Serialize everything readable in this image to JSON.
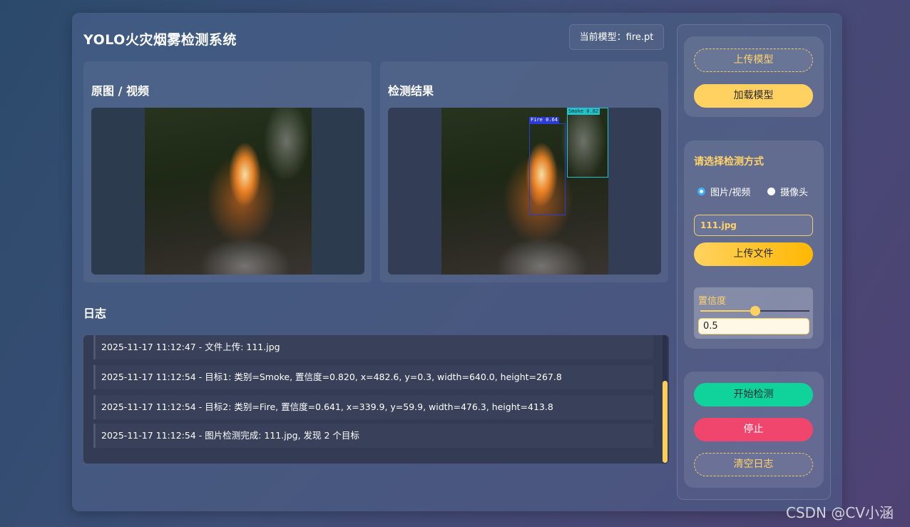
{
  "app": {
    "title": "YOLO火灾烟雾检测系统",
    "model_badge": "当前模型：fire.pt"
  },
  "panels": {
    "original_title": "原图 / 视频",
    "result_title": "检测结果"
  },
  "detections": [
    {
      "label": "Fire 0.64",
      "color": "#2b3bd6"
    },
    {
      "label": "Smoke 0.82",
      "color": "#21c4cc"
    }
  ],
  "log": {
    "title": "日志",
    "entries": [
      "2025-11-17 11:12:47 - 文件上传: 111.jpg",
      "2025-11-17 11:12:54 - 目标1: 类别=Smoke, 置信度=0.820, x=482.6, y=0.3, width=640.0, height=267.8",
      "2025-11-17 11:12:54 - 目标2: 类别=Fire, 置信度=0.641, x=339.9, y=59.9, width=476.3, height=413.8",
      "2025-11-17 11:12:54 - 图片检测完成: 111.jpg, 发现 2 个目标"
    ]
  },
  "sidebar": {
    "upload_model": "上传模型",
    "load_model": "加载模型",
    "mode_title": "请选择检测方式",
    "mode_options": [
      {
        "label": "图片/视频",
        "checked": true
      },
      {
        "label": "摄像头",
        "checked": false
      }
    ],
    "file_name": "111.jpg",
    "upload_file": "上传文件",
    "confidence_label": "置信度",
    "confidence_value": "0.5",
    "confidence_fraction": 0.5,
    "start": "开始检测",
    "stop": "停止",
    "clear_log": "清空日志"
  },
  "watermark": "CSDN @CV小涵",
  "colors": {
    "accent_gold": "#ffd160",
    "start_green": "#0fd39a",
    "stop_red": "#f0456c"
  }
}
